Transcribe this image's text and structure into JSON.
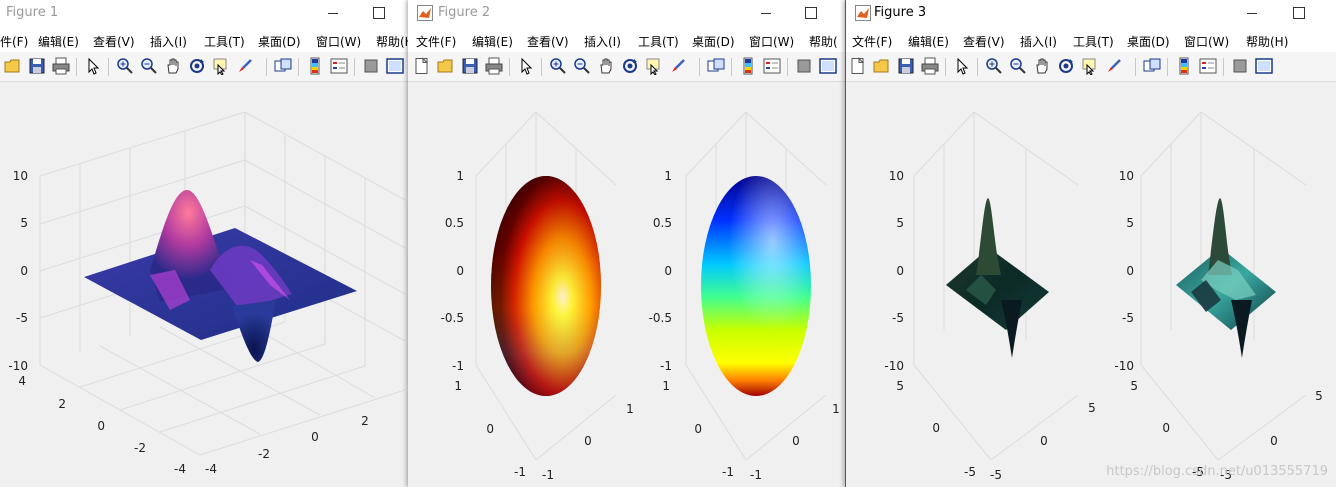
{
  "windows": [
    {
      "title": "Figure 1",
      "menu": [
        "件(F)",
        "编辑(E)",
        "查看(V)",
        "插入(I)",
        "工具(T)",
        "桌面(D)",
        "窗口(W)",
        "帮助(H"
      ]
    },
    {
      "title": "Figure 2",
      "menu": [
        "文件(F)",
        "编辑(E)",
        "查看(V)",
        "插入(I)",
        "工具(T)",
        "桌面(D)",
        "窗口(W)",
        "帮助("
      ]
    },
    {
      "title": "Figure 3",
      "menu": [
        "文件(F)",
        "编辑(E)",
        "查看(V)",
        "插入(I)",
        "工具(T)",
        "桌面(D)",
        "窗口(W)",
        "帮助(H)"
      ]
    }
  ],
  "plots": {
    "fig1": {
      "z_ticks": [
        "10",
        "5",
        "0",
        "-5",
        "-10"
      ],
      "y_ticks": [
        "4",
        "2",
        "0",
        "-2",
        "-4"
      ],
      "x_ticks": [
        "-4",
        "-2",
        "0",
        "2"
      ]
    },
    "fig2": {
      "z_ticks": [
        "1",
        "0.5",
        "0",
        "-0.5",
        "-1"
      ],
      "y_ticks": [
        "1",
        "0",
        "-1"
      ],
      "x_ticks": [
        "-1",
        "0",
        "1"
      ]
    },
    "fig3": {
      "z_ticks": [
        "10",
        "5",
        "0",
        "-5",
        "-10"
      ],
      "y_ticks": [
        "5",
        "0",
        "-5"
      ],
      "x_ticks": [
        "-5",
        "0",
        "5"
      ]
    }
  },
  "watermark": "https://blog.csdn.net/u013555719",
  "colors": {
    "titlebar": "#ffffff",
    "toolbar": "#f5f5f5",
    "figure_bg": "#f0f0f0"
  },
  "icons": [
    "new-icon",
    "open-icon",
    "save-icon",
    "print-icon",
    "pointer-icon",
    "zoom-in-icon",
    "zoom-out-icon",
    "pan-icon",
    "rotate-icon",
    "data-cursor-icon",
    "brush-icon",
    "link-icon",
    "colorbar-icon",
    "legend-icon",
    "hide-icon",
    "show-icon"
  ]
}
